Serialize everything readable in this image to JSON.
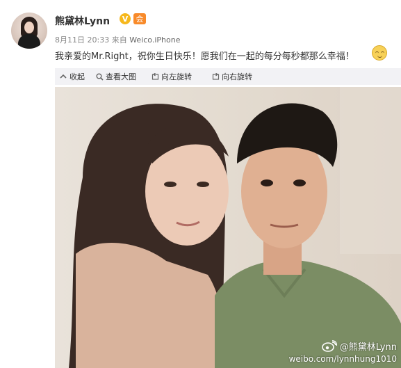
{
  "post": {
    "username": "熊黛林Lynn",
    "badge_verified": "V",
    "badge_member": "会",
    "date": "8月11日 20:33",
    "source_prefix": "来自",
    "source": "Weico.iPhone",
    "text": "我亲爱的Mr.Right，祝你生日快乐！愿我们在一起的每分每秒都那么幸福！",
    "emoji": "smiley-icon"
  },
  "toolbar": {
    "collapse": "收起",
    "view_large": "查看大图",
    "rotate_left": "向左旋转",
    "rotate_right": "向右旋转"
  },
  "photo": {
    "watermark_user": "@熊黛林Lynn",
    "watermark_url": "weibo.com/lynnhung1010"
  },
  "colors": {
    "toolbar_bg": "#f2f2f5",
    "badge_verified": "#f6b81c",
    "badge_member": "#f88a2a"
  }
}
